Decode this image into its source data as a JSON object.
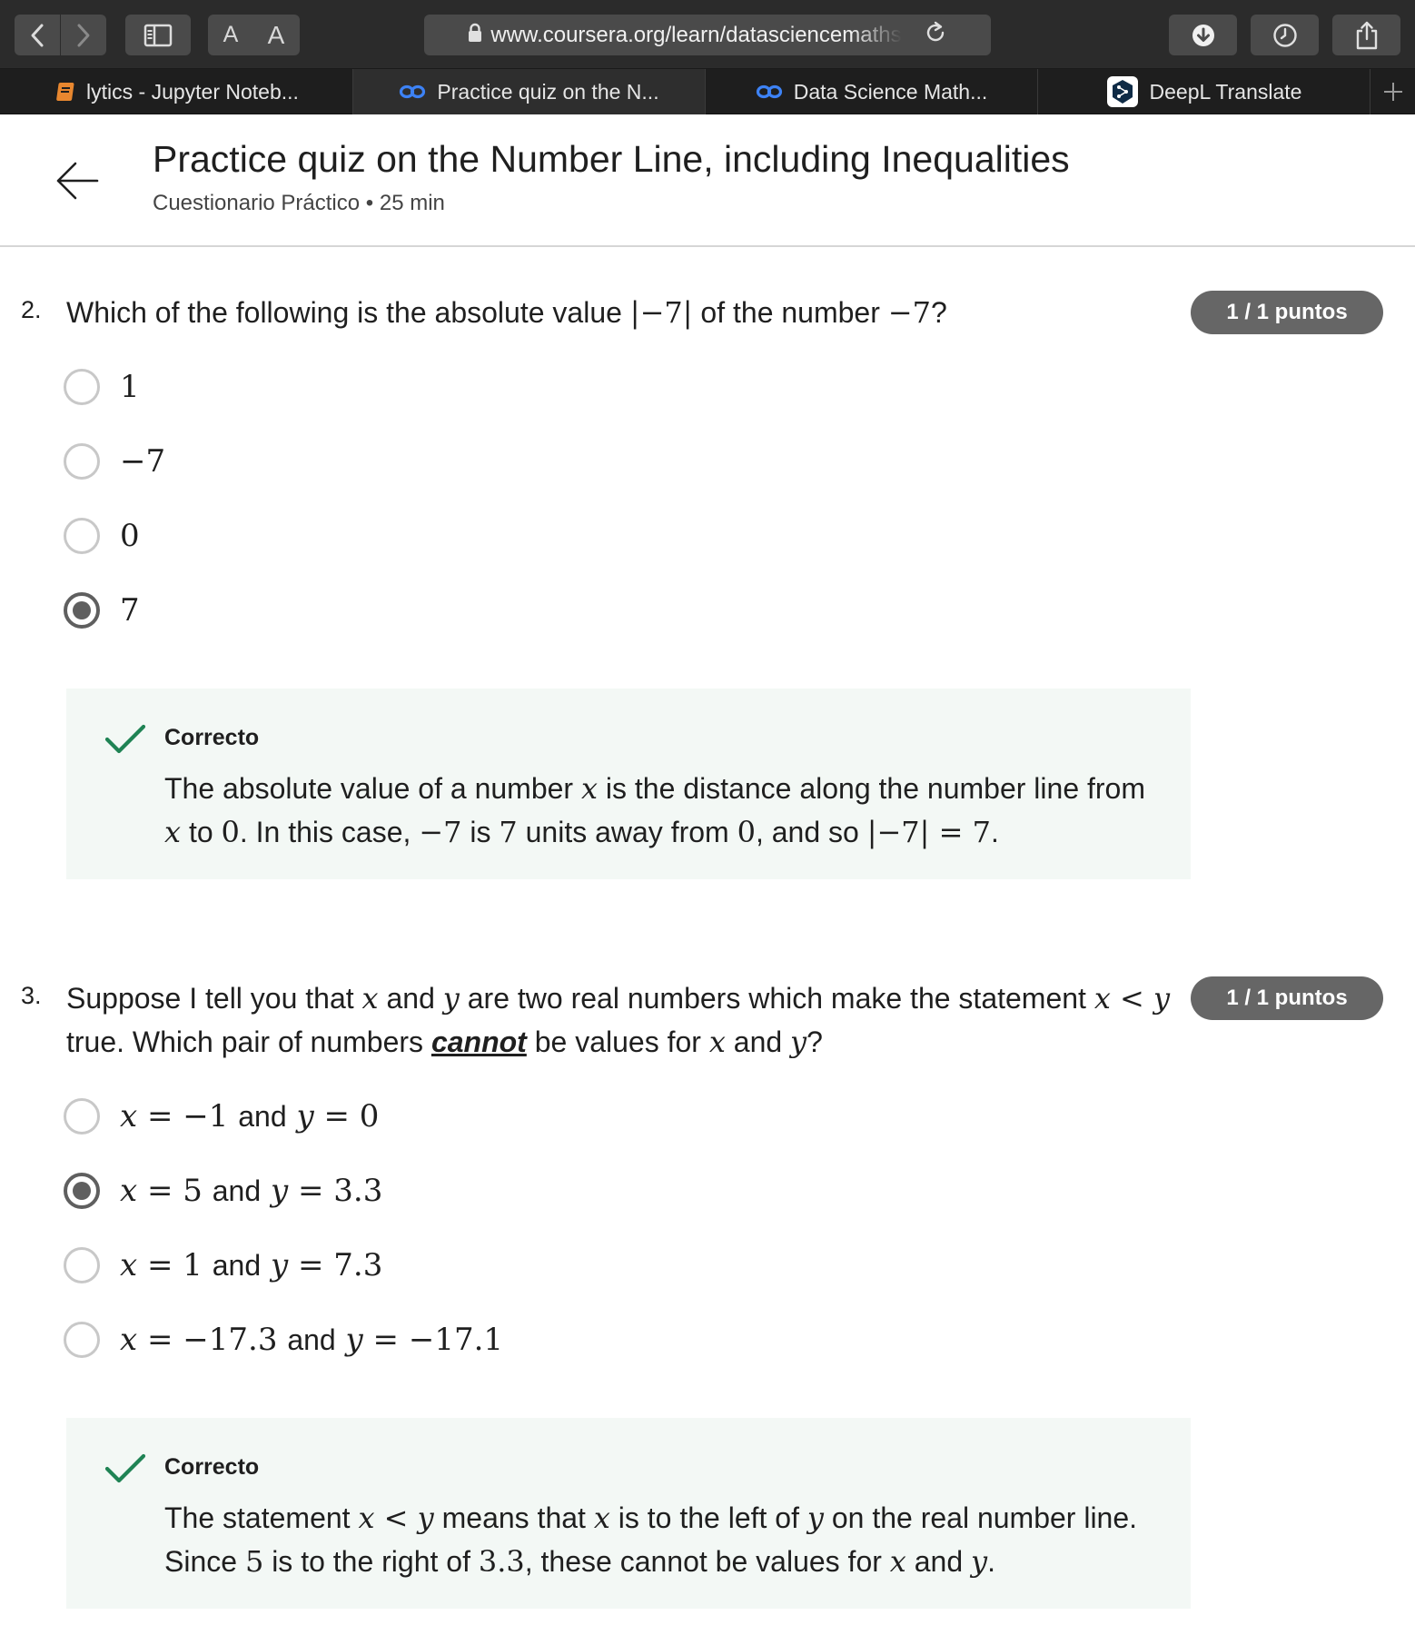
{
  "browser": {
    "url": "www.coursera.org/learn/datasciencemaths",
    "font_small_label": "A",
    "font_large_label": "A"
  },
  "tabs": [
    {
      "label": "lytics - Jupyter Noteb...",
      "icon": "notebook-icon",
      "active": false
    },
    {
      "label": "Practice quiz on the N...",
      "icon": "coursera-icon",
      "active": true
    },
    {
      "label": "Data Science Math...",
      "icon": "coursera-icon",
      "active": false
    },
    {
      "label": "DeepL Translate",
      "icon": "deepl-icon",
      "active": false
    }
  ],
  "header": {
    "title": "Practice quiz on the Number Line, including Inequalities",
    "subtitle": "Cuestionario Práctico • 25 min"
  },
  "questions": [
    {
      "number": "2.",
      "text_parts": [
        "Which of the following is the absolute value ",
        "|−7|",
        " of the number ",
        "−7",
        "?"
      ],
      "points": "1 / 1 puntos",
      "options": [
        {
          "label": "1",
          "selected": false
        },
        {
          "label": "−7",
          "selected": false
        },
        {
          "label": "0",
          "selected": false
        },
        {
          "label": "7",
          "selected": true
        }
      ],
      "feedback": {
        "status": "Correcto",
        "parts": [
          "The absolute value of a number ",
          "x",
          " is the distance along the number line from ",
          "x",
          " to ",
          "0",
          ". In this case, ",
          "−7",
          " is ",
          "7",
          " units away from ",
          "0",
          ", and so ",
          "|−7| = 7",
          "."
        ]
      }
    },
    {
      "number": "3.",
      "text_parts": [
        "Suppose I tell you that ",
        "x",
        " and ",
        "y",
        " are two real numbers which make the statement ",
        "x < y",
        " true. Which pair of numbers ",
        "cannot",
        " be values for ",
        "x",
        " and ",
        "y",
        "?"
      ],
      "points": "1 / 1 puntos",
      "options": [
        {
          "x_lhs": "x",
          "x_val": "= −1",
          "and": "and",
          "y_lhs": "y",
          "y_val": "= 0",
          "selected": false
        },
        {
          "x_lhs": "x",
          "x_val": "= 5",
          "and": "and",
          "y_lhs": "y",
          "y_val": "= 3.3",
          "selected": true
        },
        {
          "x_lhs": "x",
          "x_val": "= 1",
          "and": "and",
          "y_lhs": "y",
          "y_val": "= 7.3",
          "selected": false
        },
        {
          "x_lhs": "x",
          "x_val": "= −17.3",
          "and": "and",
          "y_lhs": "y",
          "y_val": "= −17.1",
          "selected": false
        }
      ],
      "feedback": {
        "status": "Correcto",
        "parts": [
          "The statement ",
          "x < y",
          " means that ",
          "x",
          " is to the left of ",
          "y",
          " on the real number line. Since ",
          "5",
          " is to the right of ",
          "3.3",
          ", these cannot be values for ",
          "x",
          " and ",
          "y",
          "."
        ]
      }
    }
  ],
  "colors": {
    "toolbar_bg": "#2b2b2b",
    "tabbar_bg": "#1e1e1e",
    "badge_bg": "#666666",
    "feedback_bg": "#f3f8f5",
    "check_green": "#1f8354",
    "radio_checked": "#5f5f5f"
  }
}
